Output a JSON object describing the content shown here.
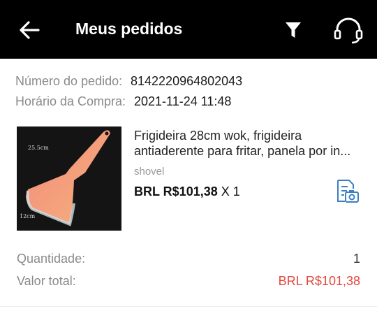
{
  "header": {
    "title": "Meus pedidos",
    "back_icon": "arrow-left-icon",
    "filter_icon": "filter-icon",
    "support_icon": "headset-icon"
  },
  "order": {
    "number_label": "Número do pedido:",
    "number_value": "8142220964802043",
    "purchase_time_label": "Horário da Compra:",
    "purchase_time_value": "2021-11-24 11:48"
  },
  "product": {
    "image_text_length": "25.5cm",
    "image_text_width": "12cm",
    "name_line1": "Frigideira 28cm wok, frigideira",
    "name_line2": "antiaderente para fritar, panela por in...",
    "variant": "shovel",
    "price": "BRL R$101,38",
    "quantity_text": "X 1",
    "review_icon": "document-camera-icon"
  },
  "summary": {
    "quantity_label": "Quantidade:",
    "quantity_value": "1",
    "total_label": "Valor total:",
    "total_value": "BRL R$101,38"
  },
  "colors": {
    "header_bg": "#000000",
    "accent_blue": "#3b7fc4",
    "price_red": "#e0493f"
  }
}
